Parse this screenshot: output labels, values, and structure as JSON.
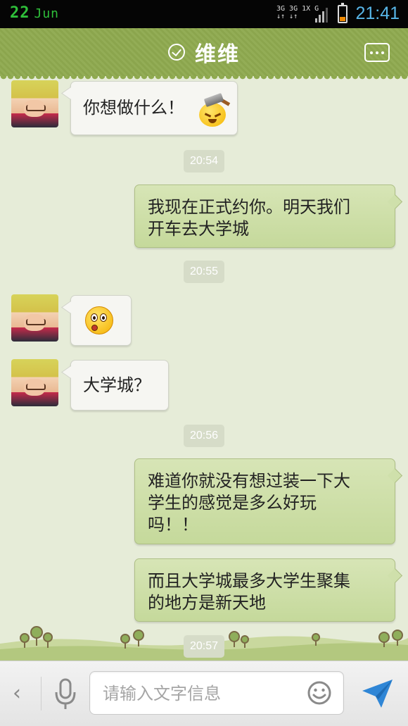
{
  "status_bar": {
    "date_day": "22",
    "date_month": "Jun",
    "network_line1": "3G 3G 1X G",
    "network_line2": "↓↑ ↓↑",
    "time": "21:41",
    "battery_level": 0.25
  },
  "header": {
    "title": "维维",
    "more_icon": "more-dots-icon",
    "verified_icon": "check-circle-icon"
  },
  "messages": [
    {
      "sender": "contact",
      "type": "text",
      "text": "你想做什么！",
      "emoji": "hammer-face-emoji"
    },
    {
      "type": "time",
      "text": "20:54"
    },
    {
      "sender": "me",
      "type": "text",
      "lines": [
        "我现在正式约你。明天我们",
        "开车去大学城"
      ]
    },
    {
      "type": "time",
      "text": "20:55"
    },
    {
      "sender": "contact",
      "type": "emoji",
      "emoji": "surprised-face-emoji"
    },
    {
      "sender": "contact",
      "type": "text",
      "text": "大学城？"
    },
    {
      "type": "time",
      "text": "20:56"
    },
    {
      "sender": "me",
      "type": "text",
      "lines": [
        "难道你就没有想过装一下大",
        "学生的感觉是多么好玩",
        "吗！！"
      ]
    },
    {
      "sender": "me",
      "type": "text",
      "lines": [
        "而且大学城最多大学生聚集",
        "的地方是新天地"
      ]
    },
    {
      "type": "time",
      "text": "20:57"
    }
  ],
  "input_bar": {
    "placeholder": "请输入文字信息",
    "back_icon": "chevron-left-icon",
    "mic_icon": "microphone-icon",
    "emoji_icon": "smiley-icon",
    "send_icon": "send-plane-icon"
  },
  "colors": {
    "header_green": "#8faa4f",
    "chat_background": "#e6ecd8",
    "outgoing_bubble": "#cfe0ab",
    "incoming_bubble": "#f6f6f2",
    "time_accent": "#58b6e8",
    "send_blue": "#2f86d6"
  }
}
